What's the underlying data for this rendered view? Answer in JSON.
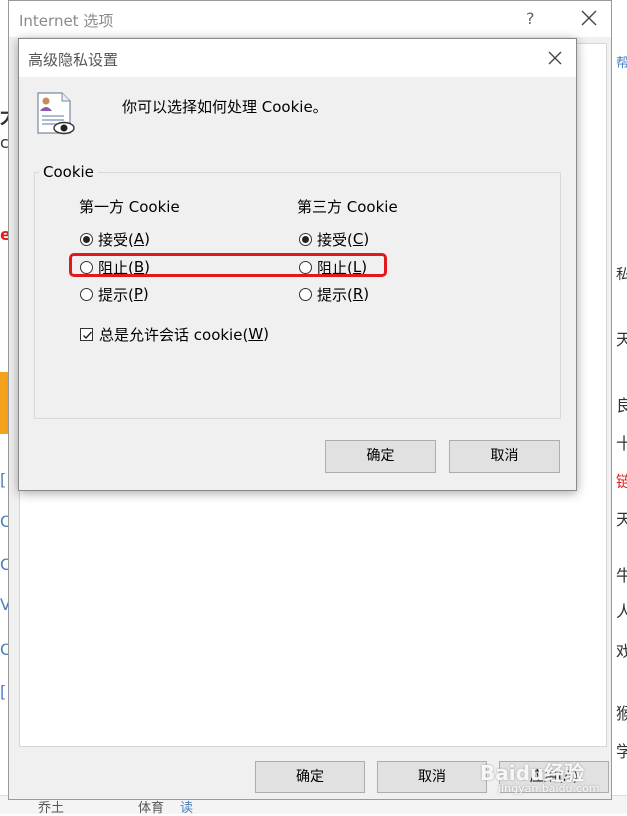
{
  "background_page": {
    "left_fragments": [
      "大",
      "c",
      "e",
      "[",
      "C",
      "C",
      "V",
      "C",
      "["
    ],
    "right_fragments": [
      "帮",
      "私",
      "天",
      "良",
      "十",
      "链",
      "天",
      "牛",
      "人",
      "戏",
      "猴",
      "学"
    ],
    "bottom_nav": [
      "乔土",
      "体育",
      "读"
    ]
  },
  "internet_options": {
    "title": "Internet 选项",
    "help": "?",
    "buttons": {
      "ok": "确定",
      "cancel": "取消",
      "apply": "应用(A)"
    }
  },
  "dialog": {
    "title": "高级隐私设置",
    "description": "你可以选择如何处理 Cookie。",
    "group_label": "Cookie",
    "first_party": {
      "heading": "第一方 Cookie",
      "options": [
        {
          "pre": "接受(",
          "key": "A",
          "post": ")",
          "checked": true
        },
        {
          "pre": "阻止(",
          "key": "B",
          "post": ")",
          "checked": false
        },
        {
          "pre": "提示(",
          "key": "P",
          "post": ")",
          "checked": false
        }
      ]
    },
    "third_party": {
      "heading": "第三方 Cookie",
      "options": [
        {
          "pre": "接受(",
          "key": "C",
          "post": ")",
          "checked": true
        },
        {
          "pre": "阻止(",
          "key": "L",
          "post": ")",
          "checked": false
        },
        {
          "pre": "提示(",
          "key": "R",
          "post": ")",
          "checked": false
        }
      ]
    },
    "session_cookie": {
      "pre": "总是允许会话 cookie(",
      "key": "W",
      "post": ")",
      "checked": true
    },
    "buttons": {
      "ok": "确定",
      "cancel": "取消"
    }
  },
  "annotation": {
    "highlight_color": "#e0191e",
    "target": "阻止 options"
  },
  "watermark": {
    "text": "Baidu经验",
    "url": "jingyan.baidu.com"
  }
}
